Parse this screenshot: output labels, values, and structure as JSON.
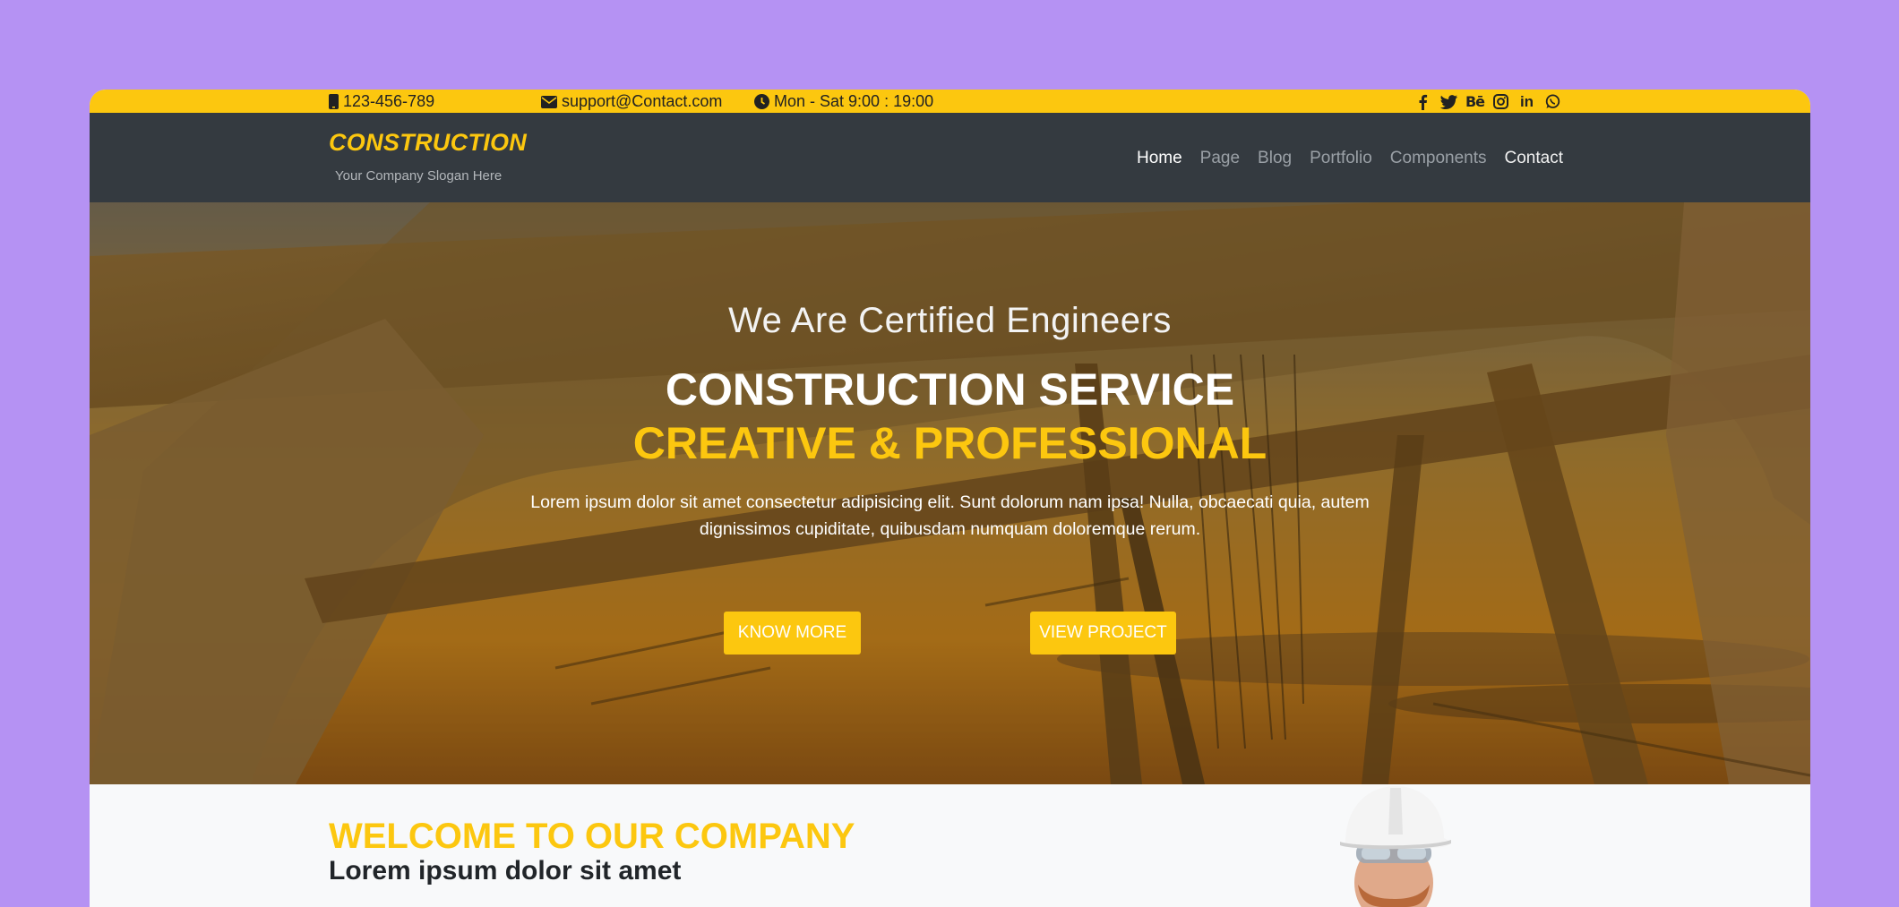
{
  "topbar": {
    "phone": "123-456-789",
    "email": "support@Contact.com",
    "hours": "Mon - Sat 9:00 : 19:00",
    "social_icons": [
      "facebook-icon",
      "twitter-icon",
      "behance-icon",
      "instagram-icon",
      "linkedin-icon",
      "whatsapp-icon"
    ],
    "behance_text": "Bē",
    "linkedin_text": "in"
  },
  "brand": {
    "name": "CONSTRUCTION",
    "slogan": "Your Company Slogan Here"
  },
  "nav": {
    "items": [
      {
        "label": "Home"
      },
      {
        "label": "Page"
      },
      {
        "label": "Blog"
      },
      {
        "label": "Portfolio"
      },
      {
        "label": "Components"
      },
      {
        "label": "Contact"
      }
    ]
  },
  "hero": {
    "subtitle": "We Are Certified Engineers",
    "title": "CONSTRUCTION SERVICE",
    "title2": "CREATIVE & PROFESSIONAL",
    "text": "Lorem ipsum dolor sit amet consectetur adipisicing elit. Sunt dolorum nam ipsa! Nulla, obcaecati quia, autem dignissimos cupiditate, quibusdam numquam doloremque rerum.",
    "know_more": "KNOW MORE",
    "view_project": "VIEW PROJECT"
  },
  "welcome": {
    "title": "WELCOME TO OUR COMPANY",
    "subtitle": "Lorem ipsum dolor sit amet"
  },
  "colors": {
    "accent": "#fcc70f",
    "navbar": "#343a40",
    "page_bg": "#b592f3"
  }
}
